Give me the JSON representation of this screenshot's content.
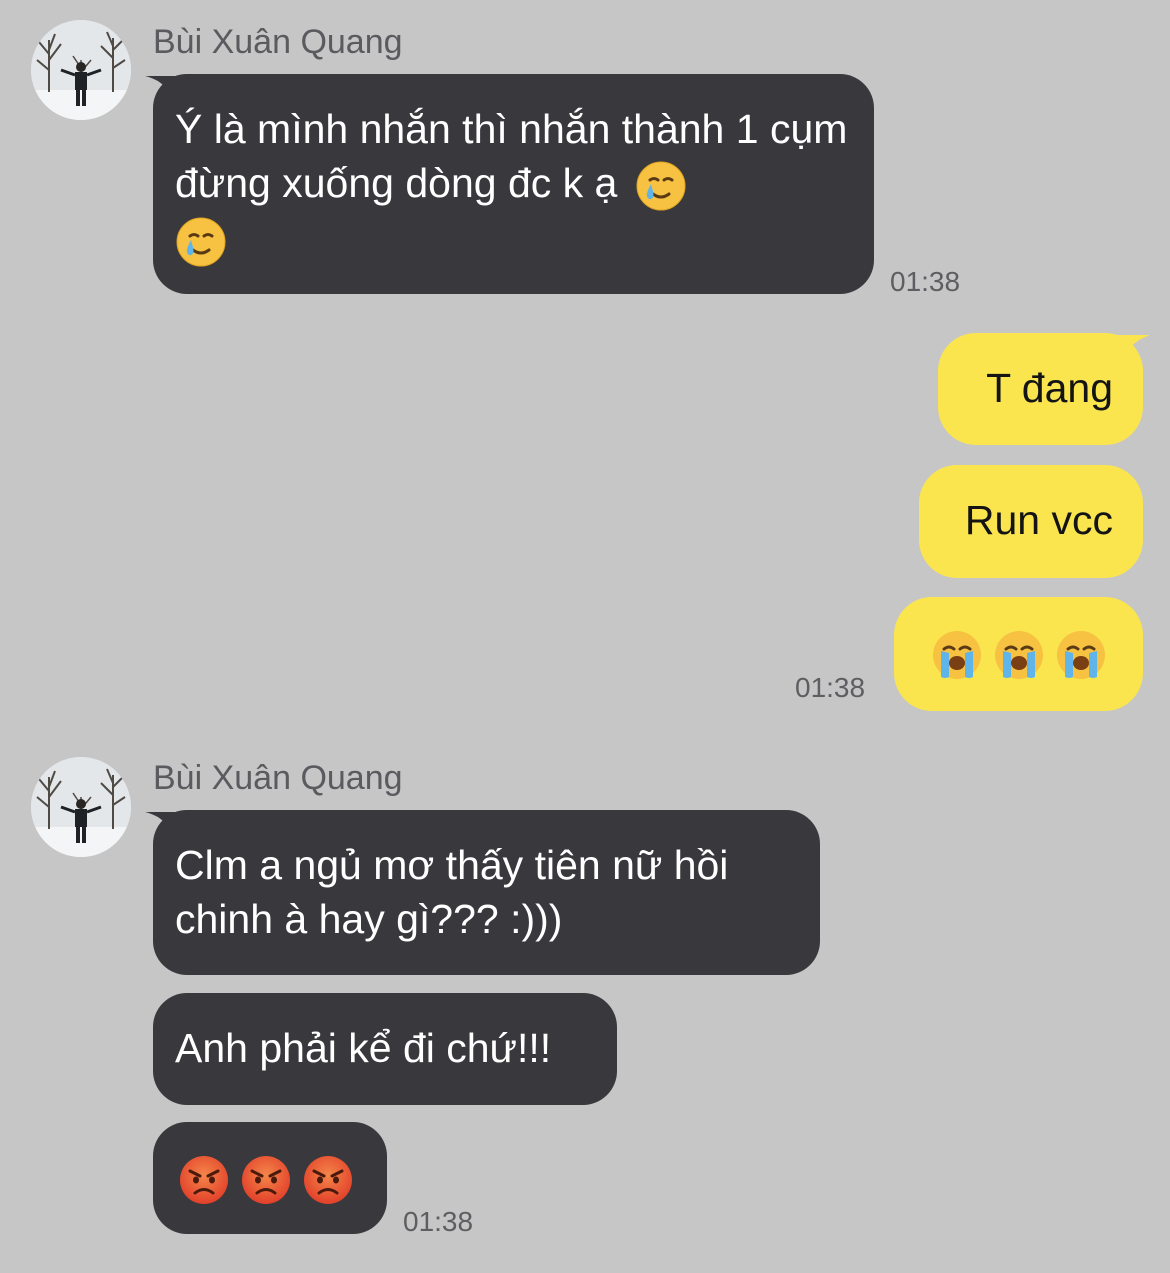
{
  "colors": {
    "background": "#c6c6c6",
    "incoming_bubble": "#39393d",
    "outgoing_bubble": "#fae54f",
    "incoming_text": "#ffffff",
    "outgoing_text": "#141414",
    "meta_text": "#5e5e62"
  },
  "groups": [
    {
      "sender": "Bùi Xuân Quang",
      "avatar": "avatar-photo",
      "messages": [
        {
          "text": "Ý là mình nhắn thì nhắn thành 1 cụm đừng xuống dòng đc k ạ",
          "emojis": [
            "smiling-face-with-tear-icon",
            "smiling-face-with-tear-icon"
          ]
        }
      ],
      "time": "01:38"
    },
    {
      "sender": "",
      "messages": [
        {
          "text": "T đang"
        },
        {
          "text": "Run vcc"
        },
        {
          "text": "",
          "emojis": [
            "loudly-crying-face-icon",
            "loudly-crying-face-icon",
            "loudly-crying-face-icon"
          ]
        }
      ],
      "time": "01:38"
    },
    {
      "sender": "Bùi Xuân Quang",
      "avatar": "avatar-photo",
      "messages": [
        {
          "text": "Clm a ngủ mơ thấy tiên nữ hồi chinh à hay gì??? :)))"
        },
        {
          "text": "Anh phải kể đi chứ!!!"
        },
        {
          "text": "",
          "emojis": [
            "angry-face-icon",
            "angry-face-icon",
            "angry-face-icon"
          ]
        }
      ],
      "time": "01:38"
    }
  ]
}
